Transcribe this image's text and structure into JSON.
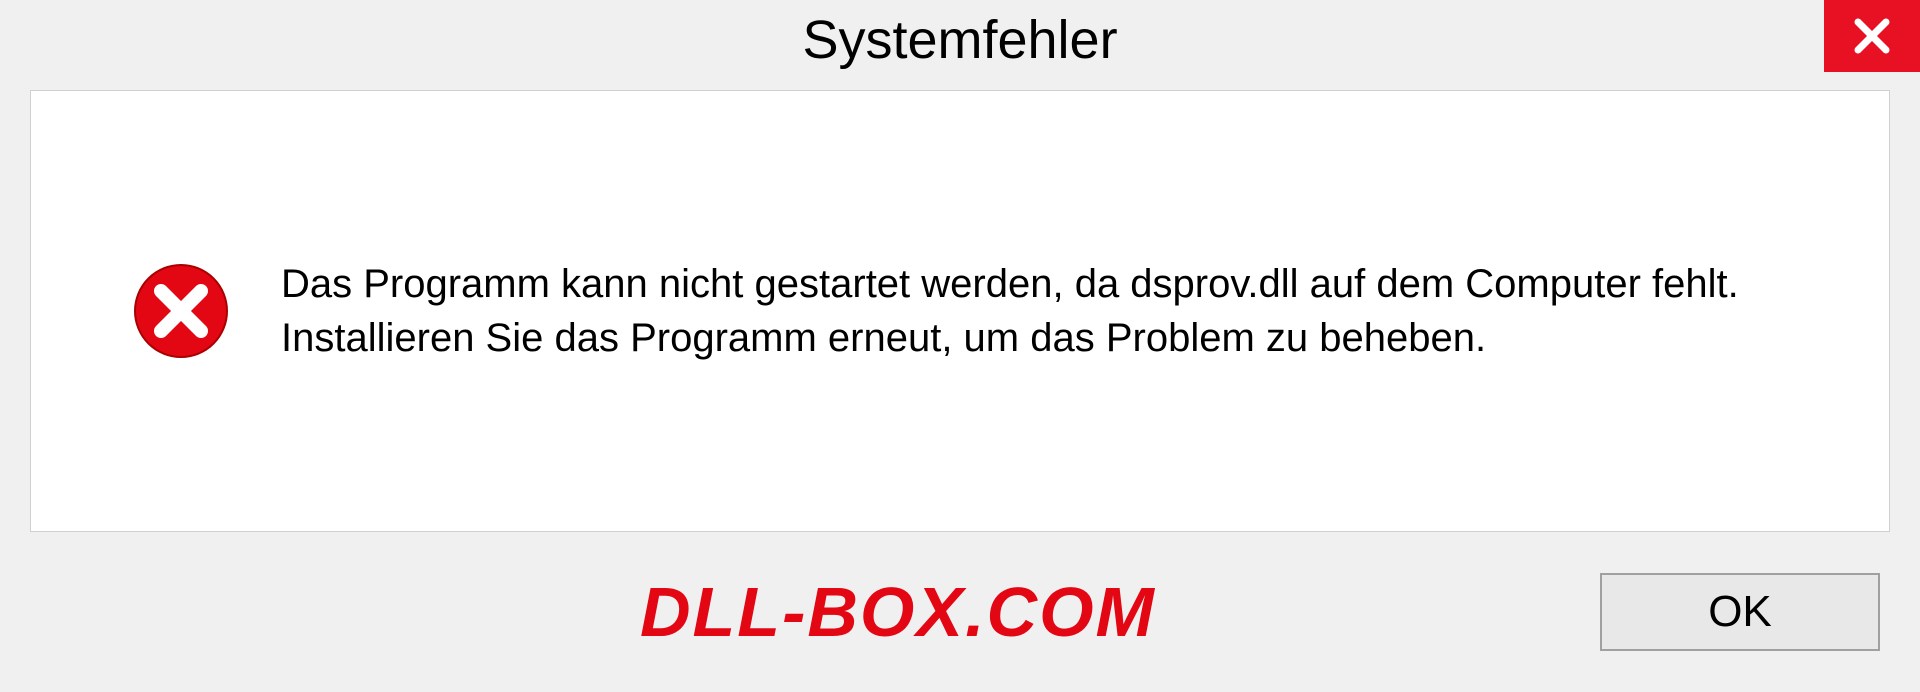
{
  "dialog": {
    "title": "Systemfehler",
    "message": "Das Programm kann nicht gestartet werden, da dsprov.dll auf dem Computer fehlt. Installieren Sie das Programm erneut, um das Problem zu beheben.",
    "ok_label": "OK"
  },
  "watermark": "DLL-BOX.COM"
}
